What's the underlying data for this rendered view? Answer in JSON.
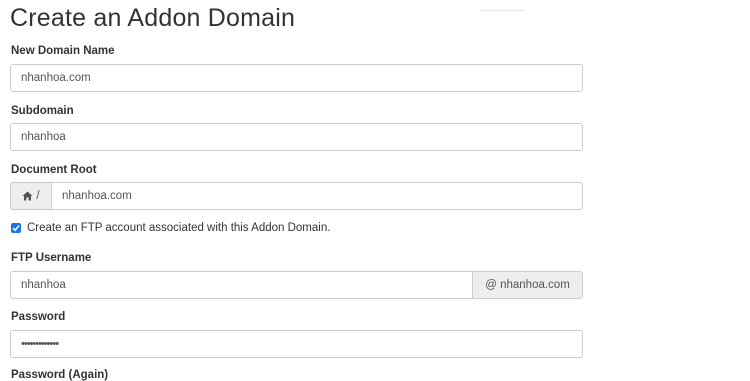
{
  "page": {
    "title": "Create an Addon Domain"
  },
  "form": {
    "new_domain": {
      "label": "New Domain Name",
      "value": "nhanhoa.com"
    },
    "subdomain": {
      "label": "Subdomain",
      "value": "nhanhoa"
    },
    "document_root": {
      "label": "Document Root",
      "prefix": "/",
      "value": "nhanhoa.com"
    },
    "ftp_checkbox": {
      "label": "Create an FTP account associated with this Addon Domain.",
      "checked": true
    },
    "ftp_username": {
      "label": "FTP Username",
      "value": "nhanhoa",
      "suffix": "@ nhanhoa.com"
    },
    "password": {
      "label": "Password",
      "value": "•••••••••••••"
    },
    "password_again": {
      "label": "Password (Again)"
    }
  },
  "icons": {
    "home": "home-icon",
    "check": "check-icon"
  },
  "colors": {
    "checkbox": "#1a73e8",
    "addon_bg": "#eeeeee",
    "border": "#cccccc"
  }
}
